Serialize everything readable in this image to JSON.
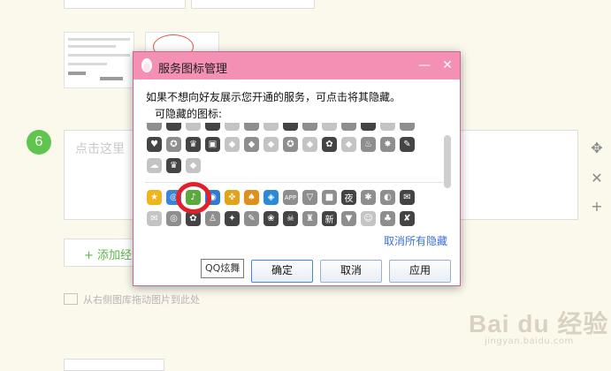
{
  "page": {
    "step_number": "6",
    "textarea_placeholder": "点击这里",
    "add_button_label": "+ 添加经",
    "drag_hint": "从右侧图库拖动图片到此处",
    "side_tools": [
      "move-icon",
      "close-icon",
      "plus-icon"
    ],
    "watermark": {
      "main": "Bai du 经验",
      "sub": "jingyan.baidu.com"
    }
  },
  "dialog": {
    "title": "服务图标管理",
    "description": "如果不想向好友展示您开通的服务，可点击将其隐藏。",
    "hidden_section_label": "可隐藏的图标:",
    "unhide_all_link": "取消所有隐藏",
    "tooltip": "QQ炫舞",
    "buttons": {
      "ok": "确定",
      "cancel": "取消",
      "apply": "应用"
    },
    "title_controls": [
      "minimize-icon",
      "close-icon"
    ],
    "hidden_icons_row1": [
      "♥",
      "✪",
      "♛",
      "▣",
      "◆",
      "◆",
      "◆",
      "✪",
      "◆",
      "✿",
      "◆",
      "♨",
      "✸",
      "✎"
    ],
    "hidden_icons_row2": [
      "☁",
      "♛",
      "◆"
    ],
    "visible_icons_row1": [
      "★",
      "◎",
      "♪",
      "◉",
      "✜",
      "♠",
      "◈",
      "APP",
      "▽",
      "■",
      "夜",
      "✱",
      "◐",
      "✉"
    ],
    "visible_icons_row2": [
      "✉",
      "◎",
      "✿",
      "♙",
      "✦",
      "✎",
      "❀",
      "☠",
      "♜",
      "新",
      "▼",
      "☺",
      "♣",
      "✘"
    ],
    "colors": {
      "titlebar": "#f390b3",
      "accent_link": "#3a6fd8",
      "step_green": "#5fc54f",
      "circle_red": "#e1202a"
    }
  }
}
